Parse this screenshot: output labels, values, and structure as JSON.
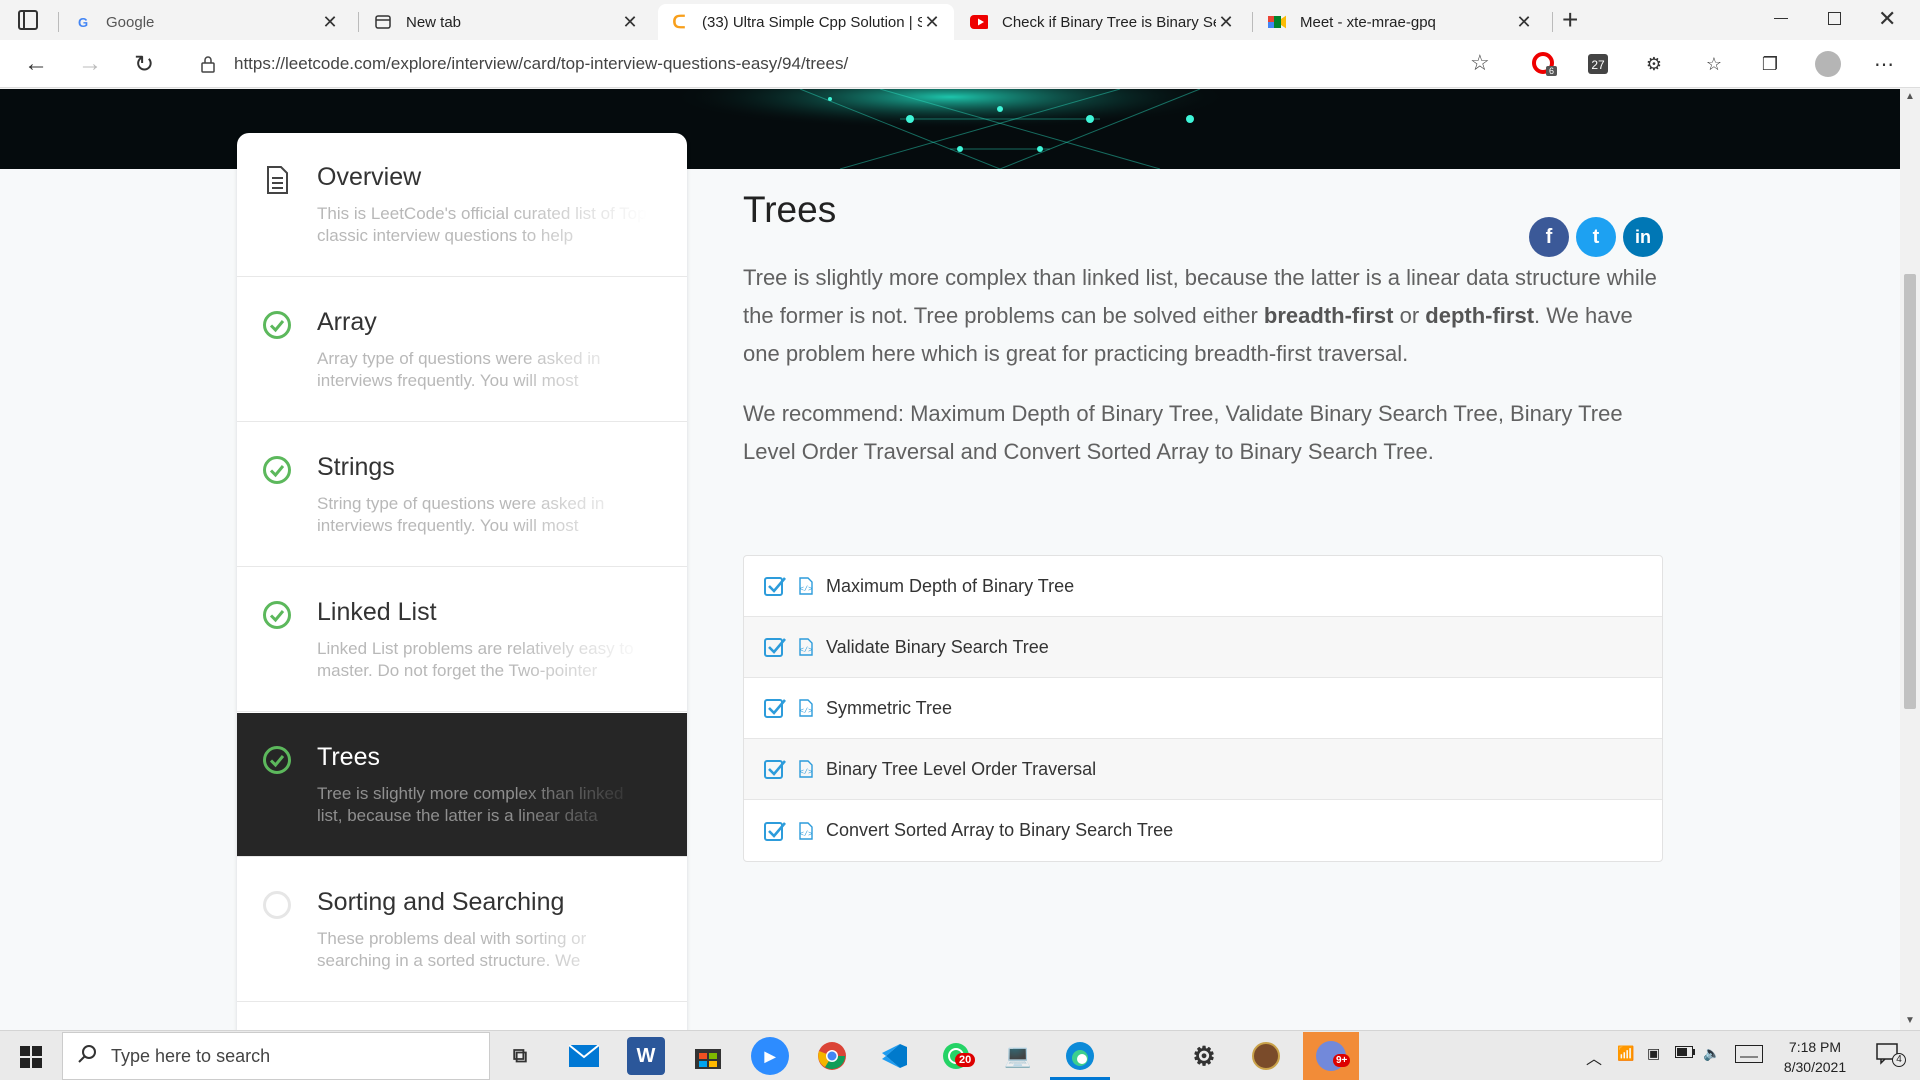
{
  "browser": {
    "tabs": [
      {
        "title": "Google",
        "icon": "google-icon"
      },
      {
        "title": "New tab",
        "icon": "newtab-icon"
      },
      {
        "title": "(33) Ultra Simple Cpp Solution | S",
        "icon": "leetcode-icon",
        "active": true
      },
      {
        "title": "Check if Binary Tree is Binary Sea",
        "icon": "youtube-icon"
      },
      {
        "title": "Meet - xte-mrae-gpq",
        "icon": "meet-icon"
      }
    ],
    "url": "https://leetcode.com/explore/interview/card/top-interview-questions-easy/94/trees/",
    "extension_badge": "6"
  },
  "sidebar": {
    "items": [
      {
        "title": "Overview",
        "desc": "This is LeetCode's official curated list of Top classic interview questions to help",
        "status": "doc"
      },
      {
        "title": "Array",
        "desc": "Array type of questions were asked in interviews frequently. You will most",
        "status": "done"
      },
      {
        "title": "Strings",
        "desc": "String type of questions were asked in interviews frequently. You will most",
        "status": "done"
      },
      {
        "title": "Linked List",
        "desc": "Linked List problems are relatively easy to master. Do not forget the Two-pointer",
        "status": "done"
      },
      {
        "title": "Trees",
        "desc": "Tree is slightly more complex than linked list, because the latter is a linear data",
        "status": "done",
        "active": true
      },
      {
        "title": "Sorting and Searching",
        "desc": "These problems deal with sorting or searching in a sorted structure. We",
        "status": "todo"
      }
    ]
  },
  "main": {
    "title": "Trees",
    "para1_a": "Tree is slightly more complex than linked list, because the latter is a linear data structure while the former is not. Tree problems can be solved either ",
    "para1_b1": "breadth-first",
    "para1_or": " or ",
    "para1_b2": "depth-first",
    "para1_c": ". We have one problem here which is great for practicing breadth-first traversal.",
    "para2": "We recommend: Maximum Depth of Binary Tree, Validate Binary Search Tree, Binary Tree Level Order Traversal and Convert Sorted Array to Binary Search Tree.",
    "social": {
      "facebook": "f",
      "twitter": "t",
      "linkedin": "in"
    },
    "questions": [
      "Maximum Depth of Binary Tree",
      "Validate Binary Search Tree",
      "Symmetric Tree",
      "Binary Tree Level Order Traversal",
      "Convert Sorted Array to Binary Search Tree"
    ]
  },
  "taskbar": {
    "search_placeholder": "Type here to search",
    "whatsapp_badge": "20",
    "notif_badge": "9+",
    "time": "7:18 PM",
    "date": "8/30/2021",
    "action_center_count": "4"
  },
  "colors": {
    "accent_green": "#5cb85c",
    "check_blue": "#2d9cdb",
    "facebook": "#3b5998",
    "twitter": "#1da1f2",
    "linkedin": "#0077b5"
  }
}
